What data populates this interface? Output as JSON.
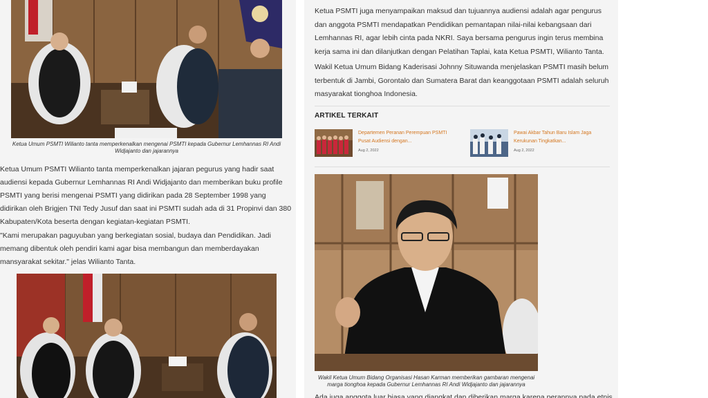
{
  "left": {
    "photo1_caption": "Ketua Umum PSMTI Wilianto tanta memperkenalkan mengenai PSMTI kepada Gubernur Lemhannas RI Andi Widjajanto dan jajarannya",
    "paragraph1": "Ketua Umum PSMTI Wilianto tanta memperkenalkan jajaran pegurus yang hadir saat audiensi kepada Gubernur Lemhannas RI Andi Widjajanto dan memberikan buku profile PSMTI yang berisi mengenai PSMTI yang didirikan pada 28 September 1998 yang didirikan oleh Brigjen TNI Tedy Jusuf dan saat ini PSMTI sudah ada di 31 Propinvi dan 380 Kabupaten/Kota beserta dengan kegiatan-kegiatan PSMTI.",
    "paragraph2": "\"Kami merupakan paguyuban yang berkegiatan sosial, budaya dan Pendidikan. Jadi memang dibentuk oleh pendiri kami agar bisa membangun dan memberdayakan mansyarakat sekitar.\" jelas Wilianto Tanta."
  },
  "right": {
    "paragraph1": "Ketua PSMTI juga menyampaikan maksud dan tujuannya audiensi adalah agar pengurus dan anggota PSMTI mendapatkan Pendidikan pemantapan nilai-nilai kebangsaan dari Lemhannas RI, agar lebih cinta pada NKRI. Saya bersama pengurus ingin terus membina kerja sama ini dan dilanjutkan dengan Pelatihan Taplai, kata Ketua PSMTI, Wilianto Tanta.",
    "paragraph2": "Wakil Ketua Umum Bidang Kaderisasi Johnny Situwanda menjelaskan PSMTI masih belum terbentuk di Jambi, Gorontalo dan Sumatera Barat dan keanggotaan PSMTI adalah seluruh masyarakat tionghoa Indonesia.",
    "related_heading": "ARTIKEL TERKAIT",
    "related": [
      {
        "title": "Departemen Peranan Perempuan PSMTI Pusat Audiensi dengan...",
        "date": "Aug 2, 2022"
      },
      {
        "title": "Pawai Akbar Tahun Baru Islam Jaga Kerukunan Tingkatkan...",
        "date": "Aug 2, 2022"
      }
    ],
    "photo_caption": "Wakil Ketua Umum Bidang Organisasi Hasan Karman memberikan gambaran mengenai marga tionghoa kepada Gubernur Lemhannas RI Andi Widjajanto dan jajarannya",
    "paragraph3_partial": "Ada juga anggota luar biasa yang diangkat dan diberikan marga karena perannya pada etnis"
  }
}
